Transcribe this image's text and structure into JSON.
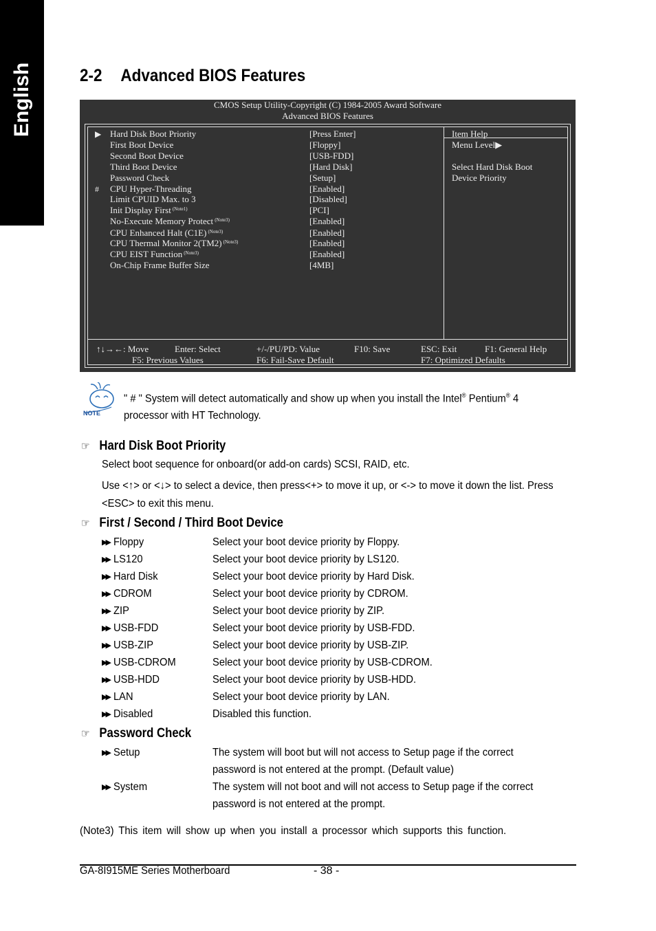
{
  "side_tab": {
    "label": "English"
  },
  "section": {
    "number": "2-2",
    "title": "Advanced BIOS Features"
  },
  "bios": {
    "header_line1": "CMOS Setup Utility-Copyright (C) 1984-2005 Award Software",
    "header_line2": "Advanced BIOS Features",
    "items": [
      {
        "mark": "▶",
        "label": "Hard Disk Boot Priority",
        "note": "",
        "value": "[Press Enter]"
      },
      {
        "mark": "",
        "label": "First Boot Device",
        "note": "",
        "value": "[Floppy]"
      },
      {
        "mark": "",
        "label": "Second Boot Device",
        "note": "",
        "value": "[USB-FDD]"
      },
      {
        "mark": "",
        "label": "Third Boot Device",
        "note": "",
        "value": "[Hard Disk]"
      },
      {
        "mark": "",
        "label": "Password Check",
        "note": "",
        "value": "[Setup]"
      },
      {
        "mark": "#",
        "label": "CPU Hyper-Threading",
        "note": "",
        "value": "[Enabled]"
      },
      {
        "mark": "",
        "label": "Limit CPUID Max. to 3",
        "note": "",
        "value": "[Disabled]"
      },
      {
        "mark": "",
        "label": "Init Display First",
        "note": "(Note1)",
        "value": "[PCI]"
      },
      {
        "mark": "",
        "label": "No-Execute Memory Protect",
        "note": "(Note3)",
        "value": "[Enabled]"
      },
      {
        "mark": "",
        "label": "CPU Enhanced Halt (C1E)",
        "note": "(Note3)",
        "value": "[Enabled]"
      },
      {
        "mark": "",
        "label": "CPU Thermal Monitor 2(TM2)",
        "note": "(Note3)",
        "value": "[Enabled]"
      },
      {
        "mark": "",
        "label": "CPU EIST Function",
        "note": "(Note3)",
        "value": "[Enabled]"
      },
      {
        "mark": "",
        "label": "On-Chip Frame Buffer Size",
        "note": "",
        "value": "[4MB]"
      }
    ],
    "help": {
      "title": "Item Help",
      "menu_level": "Menu Level▶",
      "line1": "Select Hard Disk Boot",
      "line2": "Device Priority"
    },
    "footer": {
      "move": "↑↓→←: Move",
      "enter": "Enter: Select",
      "value": "+/-/PU/PD: Value",
      "f10": "F10: Save",
      "esc": "ESC: Exit",
      "f1": "F1: General Help",
      "f5": "F5: Previous Values",
      "f6": "F6: Fail-Save Default",
      "f7": "F7: Optimized Defaults"
    }
  },
  "note": {
    "icon_label": "NOTE",
    "line1_pre": "\" # \" System will detect automatically and show up when you install the Intel",
    "reg1": "®",
    "mid": " Pentium",
    "reg2": "®",
    "line1_post": " 4",
    "line2": "processor with HT Technology."
  },
  "sections": {
    "hdbp": {
      "title": "Hard Disk Boot Priority",
      "p1": "Select boot sequence for onboard(or add-on cards) SCSI, RAID, etc.",
      "p2": "Use <↑> or <↓> to select a device, then press<+> to move it up, or <-> to move it down the list. Press",
      "p3": "<ESC> to exit this menu."
    },
    "boot": {
      "title": "First / Second / Third Boot Device",
      "options": [
        {
          "name": "Floppy",
          "desc": "Select your boot device priority by Floppy."
        },
        {
          "name": "LS120",
          "desc": "Select your boot device priority by LS120."
        },
        {
          "name": "Hard Disk",
          "desc": "Select your boot device priority by Hard Disk."
        },
        {
          "name": "CDROM",
          "desc": "Select your boot device priority by CDROM."
        },
        {
          "name": "ZIP",
          "desc": "Select your boot device priority by ZIP."
        },
        {
          "name": "USB-FDD",
          "desc": "Select your boot device priority by USB-FDD."
        },
        {
          "name": "USB-ZIP",
          "desc": "Select your boot device priority by USB-ZIP."
        },
        {
          "name": "USB-CDROM",
          "desc": "Select your boot device priority by USB-CDROM."
        },
        {
          "name": "USB-HDD",
          "desc": "Select your boot device priority by USB-HDD."
        },
        {
          "name": "LAN",
          "desc": "Select your boot device priority by LAN."
        },
        {
          "name": "Disabled",
          "desc": "Disabled this function."
        }
      ]
    },
    "password": {
      "title": "Password Check",
      "options": [
        {
          "name": "Setup",
          "desc1": "The system will boot but will not access to Setup page if the correct",
          "desc2": "password is not entered at the prompt. (Default value)"
        },
        {
          "name": "System",
          "desc1": "The system will not boot and will not access to Setup page if the correct",
          "desc2": "password is not entered at the prompt."
        }
      ]
    }
  },
  "footnote": "(Note3)  This item will show up when you install a processor which supports this function.",
  "footer": {
    "model": "GA-8I915ME Series Motherboard",
    "page": "- 38 -"
  }
}
